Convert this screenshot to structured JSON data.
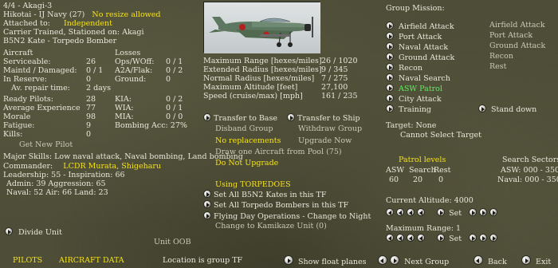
{
  "unit": {
    "title": "4/4 - Akagi-3",
    "pilot_label": "Hikotai - IJ Navy (27)",
    "resize": "No resize allowed",
    "attached_label": "Attached to:",
    "attached_value": "Independent",
    "carrier": "Carrier Trained, Stationed on: Akagi",
    "aircraft_type": "B5N2 Kate - Torpedo Bomber"
  },
  "aircraft_stats": {
    "col1_header": "Aircraft",
    "col2_header": "Losses",
    "rows": [
      {
        "label": "Serviceable:",
        "value": "26",
        "label2": "Ops/WOff:",
        "value2": "0 / 1"
      },
      {
        "label": "Maintd / Damaged:",
        "value": "0 / 1",
        "label2": "A2A/Flak:",
        "value2": "0 / 2"
      },
      {
        "label": "In Reserve:",
        "value": "0",
        "label2": "Ground:",
        "value2": "0"
      },
      {
        "label": "Av. repair time:",
        "value": "2 days",
        "label2": "",
        "value2": ""
      }
    ]
  },
  "pilot_stats": {
    "rows": [
      {
        "label": "Ready Pilots:",
        "value": "28",
        "label2": "KIA:",
        "value2": "0 / 2"
      },
      {
        "label": "Average Experience",
        "value": "77",
        "label2": "WIA:",
        "value2": "0 / 1"
      },
      {
        "label": "Morale",
        "value": "98",
        "label2": "MIA:",
        "value2": "0 / 0"
      },
      {
        "label": "Fatigue:",
        "value": "9",
        "label2": "Bombing Acc: 27%",
        "value2": ""
      },
      {
        "label": "Kills:",
        "value": "0",
        "label2": "",
        "value2": ""
      }
    ],
    "get_new_pilot": "Get New Pilot"
  },
  "skills": {
    "major": "Major Skills:  Low naval attack, Naval bombing, Land bombing",
    "commander_label": "Commander:",
    "commander_name": "LCDR Murata, Shigeharu",
    "leadership": "Leadership: 55 - Inspiration: 66",
    "admin": "Admin: 39   Aggression: 65",
    "naval": "Naval: 52   Air: 66   Land: 23"
  },
  "ranges": {
    "rows": [
      {
        "label": "Maximum Range [hexes/miles]",
        "value": "26 / 1020"
      },
      {
        "label": "Extended Radius [hexes/miles]",
        "value": "9 / 345"
      },
      {
        "label": "Normal Radius [hexes/miles]",
        "value": "7 / 275"
      },
      {
        "label": "Maximum Altitude [feet]",
        "value": "27,100"
      },
      {
        "label": "Speed (cruise/max) [mph]",
        "value": "161 / 235"
      }
    ]
  },
  "transfers": {
    "to_base": "Transfer to Base",
    "to_ship": "Transfer to Ship",
    "disband": "Disband Group",
    "withdraw": "Withdraw Group",
    "no_replacements": "No replacements",
    "upgrade_now": "Upgrade Now",
    "draw_one": "Draw one Aircraft from Pool (75)",
    "do_not_upgrade": "Do Not Upgrade"
  },
  "torpedo": {
    "using": "Using TORPEDOES",
    "set_kates": "Set All B5N2 Kates in this TF",
    "set_torpedo": "Set All Torpedo Bombers in this TF",
    "flying_day": "Flying Day Operations - Change to Night",
    "kamikaze": "Change to Kamikaze Unit (0)"
  },
  "bottom": {
    "divide": "Divide Unit",
    "unit_oob": "Unit OOB",
    "pilots": "PILOTS",
    "aircraft_data": "AIRCRAFT DATA",
    "location": "Location is group TF",
    "show_float": "Show float planes",
    "next_group": "Next Group",
    "back": "Back",
    "exit": "Exit"
  },
  "mission": {
    "header": "Group Mission:",
    "items": [
      {
        "label": "Airfield Attack",
        "alt": "Airfield Attack",
        "active": false
      },
      {
        "label": "Port Attack",
        "alt": "Port Attack",
        "active": false
      },
      {
        "label": "Naval Attack",
        "alt": "Ground Attack",
        "active": false
      },
      {
        "label": "Ground Attack",
        "alt": "Recon",
        "active": false
      },
      {
        "label": "Recon",
        "alt": "Rest",
        "active": false
      },
      {
        "label": "Naval Search",
        "alt": "",
        "active": false
      },
      {
        "label": "ASW Patrol",
        "alt": "",
        "active": true
      },
      {
        "label": "City Attack",
        "alt": "",
        "active": false
      },
      {
        "label": "Training",
        "alt": "",
        "active": false
      }
    ],
    "stand_down": "Stand down",
    "target": "Target: None",
    "cannot_select": "Cannot Select Target"
  },
  "patrol": {
    "header": "Patrol levels",
    "asw_label": "ASW",
    "search_label": "Search",
    "rest_label": "Rest",
    "asw_value": "60",
    "search_value": "20",
    "rest_value": "0",
    "sectors_header": "Search Sectors",
    "asw_sectors": "ASW: 000 - 350",
    "naval_sectors": "Naval: 000 - 350",
    "altitude": "Current Altitude: 4000",
    "set_label": "Set",
    "max_range": "Maximum Range: 1"
  },
  "colors": {
    "background": "#4e4e38",
    "highlight_yellow": "#f5e21a",
    "active_green": "#5af05a"
  }
}
